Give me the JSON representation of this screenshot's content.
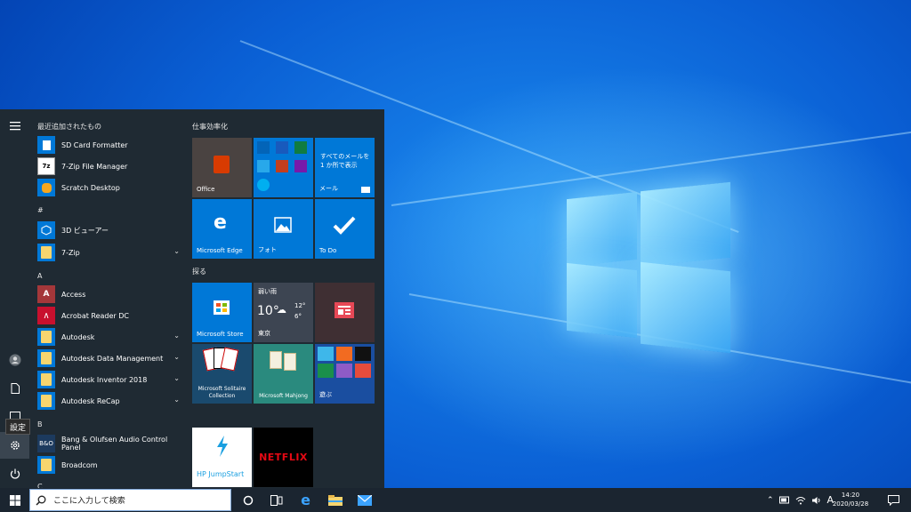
{
  "start_menu": {
    "recent_header": "最近追加されたもの",
    "recent": [
      {
        "label": "SD Card Formatter"
      },
      {
        "label": "7-Zip File Manager"
      },
      {
        "label": "Scratch Desktop"
      }
    ],
    "section_hash": "#",
    "hash_items": [
      {
        "label": "3D ビューアー"
      },
      {
        "label": "7-Zip"
      }
    ],
    "section_a": "A",
    "a_items": [
      {
        "label": "Access"
      },
      {
        "label": "Acrobat Reader DC"
      },
      {
        "label": "Autodesk"
      },
      {
        "label": "Autodesk Data Management"
      },
      {
        "label": "Autodesk Inventor 2018"
      },
      {
        "label": "Autodesk ReCap"
      }
    ],
    "section_b": "B",
    "b_items": [
      {
        "label": "Bang & Olufsen Audio Control Panel"
      },
      {
        "label": "Broadcom"
      }
    ],
    "section_c": "C",
    "settings_tooltip": "設定"
  },
  "tiles": {
    "group1": "仕事効率化",
    "office": "Office",
    "mail_text": "すべてのメールを 1 か所で表示",
    "mail_label": "メール",
    "edge": "Microsoft Edge",
    "photos": "フォト",
    "todo": "To Do",
    "group2": "探る",
    "store": "Microsoft Store",
    "weather": {
      "cond": "弱い雨",
      "temp": "10°",
      "high": "12°",
      "low": "6°",
      "city": "東京"
    },
    "solitaire": "Microsoft Solitaire Collection",
    "mahjong": "Microsoft Mahjong",
    "play": "遊ぶ",
    "hp": "HP JumpStart",
    "netflix": "NETFLIX"
  },
  "taskbar": {
    "search_placeholder": "ここに入力して検索",
    "ime": "A",
    "time": "14:20",
    "date": "2020/03/28"
  },
  "colors": {
    "accent": "#0078d7",
    "menu_bg": "#1f2a33",
    "taskbar_bg": "#1b2530",
    "folder": "#f7d56e"
  }
}
